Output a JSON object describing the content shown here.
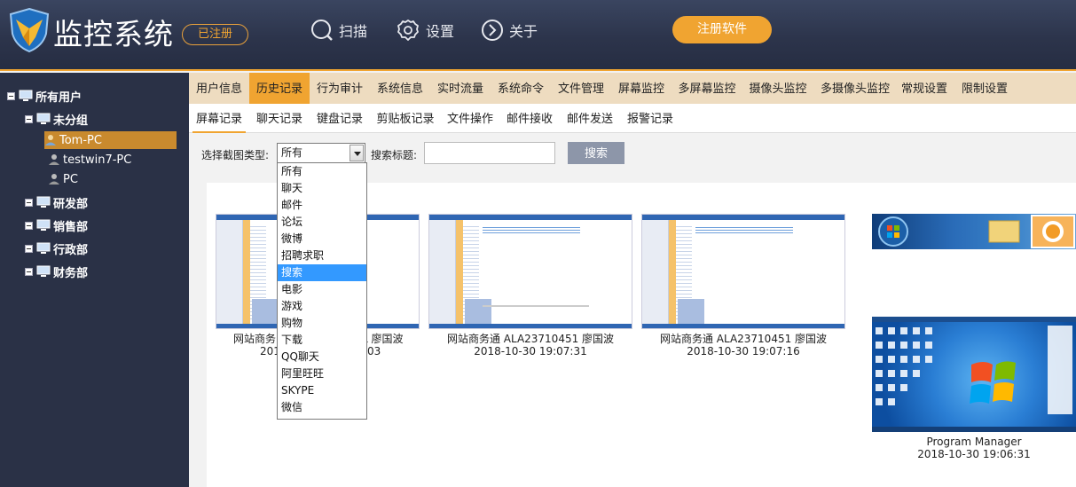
{
  "header": {
    "app_title": "监控系统",
    "registered_badge": "已注册",
    "nav": {
      "scan": "扫描",
      "settings": "设置",
      "about": "关于"
    },
    "register_button": "注册软件",
    "accent_color": "#f0a431"
  },
  "sidebar": {
    "root": "所有用户",
    "groups": [
      {
        "label": "未分组",
        "expanded": true,
        "users": [
          "Tom-PC",
          "testwin7-PC",
          "PC"
        ],
        "selected_user": "Tom-PC"
      },
      {
        "label": "研发部"
      },
      {
        "label": "销售部"
      },
      {
        "label": "行政部"
      },
      {
        "label": "财务部"
      }
    ]
  },
  "tabs": {
    "primary": [
      "用户信息",
      "历史记录",
      "行为审计",
      "系统信息",
      "实时流量",
      "系统命令",
      "文件管理",
      "屏幕监控",
      "多屏幕监控",
      "摄像头监控",
      "多摄像头监控",
      "常规设置",
      "限制设置"
    ],
    "primary_active": "历史记录",
    "secondary": [
      "屏幕记录",
      "聊天记录",
      "键盘记录",
      "剪贴板记录",
      "文件操作",
      "邮件接收",
      "邮件发送",
      "报警记录"
    ],
    "secondary_active": "屏幕记录"
  },
  "filter": {
    "type_label": "选择截图类型:",
    "type_value": "所有",
    "title_label": "搜索标题:",
    "title_value": "",
    "search_button": "搜索"
  },
  "dropdown": {
    "options": [
      "所有",
      "聊天",
      "邮件",
      "论坛",
      "微博",
      "招聘求职",
      "搜索",
      "电影",
      "游戏",
      "购物",
      "下载",
      "QQ聊天",
      "阿里旺旺",
      "SKYPE",
      "微信"
    ],
    "highlighted": "搜索"
  },
  "screenshots": [
    {
      "title": "网站商务通 ALA23710451 廖国波",
      "time": "2018-10-30 19:08:03",
      "visible_title_start": "网站商务",
      "visible_title_end": "L 廖国波",
      "visible_time_start": "201",
      "visible_time_end": "03"
    },
    {
      "title": "网站商务通 ALA23710451 廖国波",
      "time": "2018-10-30 19:07:31"
    },
    {
      "title": "网站商务通 ALA23710451 廖国波",
      "time": "2018-10-30 19:07:16"
    },
    {
      "title": "",
      "time": ""
    },
    {
      "title": "Program Manager",
      "time": "2018-10-30 19:06:31"
    }
  ]
}
